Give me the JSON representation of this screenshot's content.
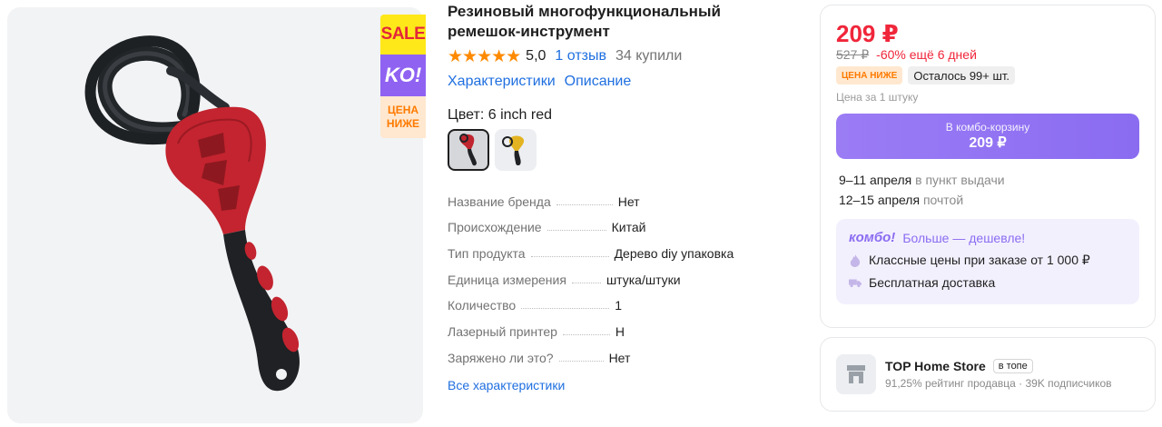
{
  "gallery": {
    "badges": {
      "sale": "SALE",
      "ko": "KO!",
      "low_line1": "ЦЕНА",
      "low_line2": "НИЖЕ"
    }
  },
  "product": {
    "title": "Резиновый многофункциональный ремешок-инструмент",
    "stars": "★★★★★",
    "rating": "5,0",
    "reviews": "1 отзыв",
    "bought": "34 купили",
    "tabs": [
      "Характеристики",
      "Описание"
    ],
    "color_label": "Цвет: 6 inch red",
    "swatches": [
      {
        "name": "red",
        "selected": true,
        "color": "#c0242e"
      },
      {
        "name": "yellow",
        "selected": false,
        "color": "#e3b321"
      }
    ],
    "specs": [
      {
        "name": "Название бренда",
        "value": "Нет"
      },
      {
        "name": "Происхождение",
        "value": "Китай"
      },
      {
        "name": "Тип продукта",
        "value": "Дерево diy упаковка"
      },
      {
        "name": "Единица измерения",
        "value": "штука/штуки"
      },
      {
        "name": "Количество",
        "value": "1"
      },
      {
        "name": "Лазерный принтер",
        "value": "Н"
      },
      {
        "name": "Заряжено ли это?",
        "value": "Нет"
      }
    ],
    "all_specs": "Все характеристики"
  },
  "buybox": {
    "price": "209 ₽",
    "old_price": "527 ₽",
    "discount": "-60% ещё 6 дней",
    "tag_low": "ЦЕНА НИЖЕ",
    "stock": "Осталось 99+ шт.",
    "unit_note": "Цена за 1 штуку",
    "combo_button_line1": "В комбо-корзину",
    "combo_button_line2": "209 ₽",
    "delivery": [
      {
        "date": "9–11 апреля",
        "method": "в пункт выдачи"
      },
      {
        "date": "12–15 апреля",
        "method": "почтой"
      }
    ],
    "combo": {
      "logo": "комбо!",
      "subtitle": "Больше — дешевле!",
      "perks": [
        {
          "icon": "flame-icon",
          "text": "Классные цены при заказе от 1 000 ₽"
        },
        {
          "icon": "truck-icon",
          "text": "Бесплатная доставка"
        }
      ]
    }
  },
  "seller": {
    "name": "TOP Home Store",
    "badge": "в топе",
    "rating": "91,25% рейтинг продавца",
    "subscribers": "39K подписчиков"
  },
  "colors": {
    "price_red": "#f0263a",
    "link_blue": "#1f6fe0",
    "combo_purple": "#8a6cf1",
    "star_orange": "#ff8a00"
  }
}
